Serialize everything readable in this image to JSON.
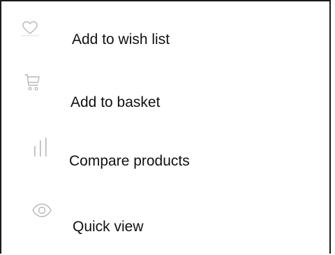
{
  "menu": {
    "items": [
      {
        "icon": "heart-icon",
        "label": "Add to wish list"
      },
      {
        "icon": "cart-icon",
        "label": "Add to basket"
      },
      {
        "icon": "compare-bars-icon",
        "label": "Compare products"
      },
      {
        "icon": "eye-icon",
        "label": "Quick view"
      }
    ]
  },
  "colors": {
    "text": "#111111",
    "icon": "#b8b8b8",
    "border": "#1a1a1a",
    "background": "#ffffff"
  }
}
